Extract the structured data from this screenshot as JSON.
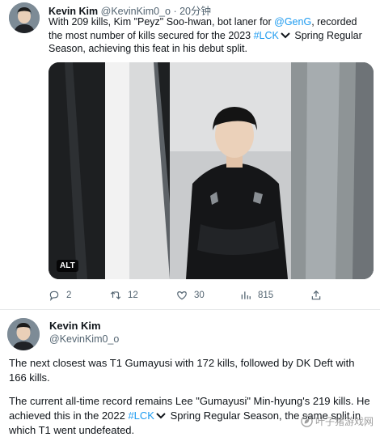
{
  "tweet1": {
    "author_name": "Kevin Kim",
    "author_handle": "@KevinKim0_o",
    "separator": "·",
    "time": "20分钟",
    "text": {
      "part1": "With 209 kills, Kim \"Peyz\" Soo-hwan, bot laner for ",
      "mention": "@GenG",
      "part2": ", recorded the most number of kills secured for the 2023 ",
      "hashtag": "#LCK",
      "part3": " Spring Regular Season, achieving this feat in his debut split."
    },
    "media": {
      "alt_badge": "ALT"
    },
    "actions": {
      "replies": "2",
      "retweets": "12",
      "likes": "30",
      "views": "815"
    }
  },
  "tweet2": {
    "author_name": "Kevin Kim",
    "author_handle": "@KevinKim0_o",
    "paragraph1": "The next closest was T1 Gumayusi with 172 kills, followed by DK Deft with 166 kills.",
    "paragraph2": {
      "part1": "The current all-time record remains Lee \"Gumayusi\" Min-hyung's 219 kills. He achieved this in the 2022 ",
      "hashtag": "#LCK",
      "part2": " Spring Regular Season, the same split in which T1 went undefeated."
    }
  },
  "watermark": {
    "text": "叶子猪游戏网"
  },
  "colors": {
    "link": "#1d9bf0",
    "secondary_text": "#536471",
    "primary_text": "#0f1419",
    "divider": "#e7e9ea"
  },
  "icons": [
    "reply-icon",
    "retweet-icon",
    "like-icon",
    "views-icon",
    "share-icon",
    "chevron-down-icon"
  ]
}
